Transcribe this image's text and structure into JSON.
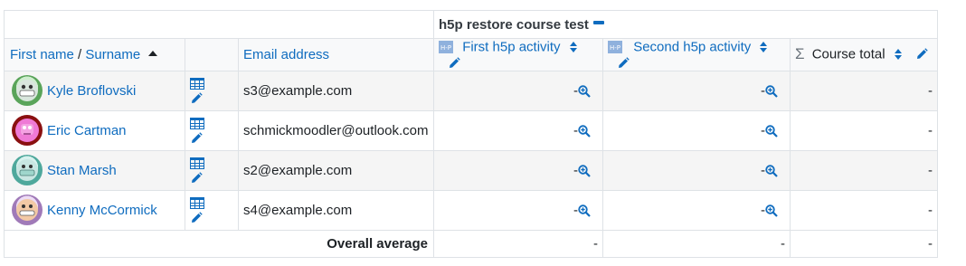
{
  "category": {
    "title": "h5p restore course test"
  },
  "headers": {
    "first_name": "First name",
    "separator": " / ",
    "surname": "Surname",
    "email": "Email address",
    "items": [
      {
        "label": "First h5p activity",
        "icon": "h5p-module-icon"
      },
      {
        "label": "Second h5p activity",
        "icon": "h5p-module-icon"
      }
    ],
    "course_total": "Course total"
  },
  "students": [
    {
      "name": "Kyle Broflovski",
      "email": "s3@example.com",
      "grade1": "-",
      "grade2": "-",
      "total": "-",
      "avatar_color": "#9ad39a"
    },
    {
      "name": "Eric Cartman",
      "email": "schmickmoodler@outlook.com",
      "grade1": "-",
      "grade2": "-",
      "total": "-",
      "avatar_color": "#e070c8"
    },
    {
      "name": "Stan Marsh",
      "email": "s2@example.com",
      "grade1": "-",
      "grade2": "-",
      "total": "-",
      "avatar_color": "#7fd3c8"
    },
    {
      "name": "Kenny McCormick",
      "email": "s4@example.com",
      "grade1": "-",
      "grade2": "-",
      "total": "-",
      "avatar_color": "#c7a2d8"
    }
  ],
  "average": {
    "label": "Overall average",
    "grade1": "-",
    "grade2": "-",
    "total": "-"
  },
  "colors": {
    "link": "#0f6cbf",
    "border": "#dee2e6",
    "stripe": "#f5f5f5"
  }
}
